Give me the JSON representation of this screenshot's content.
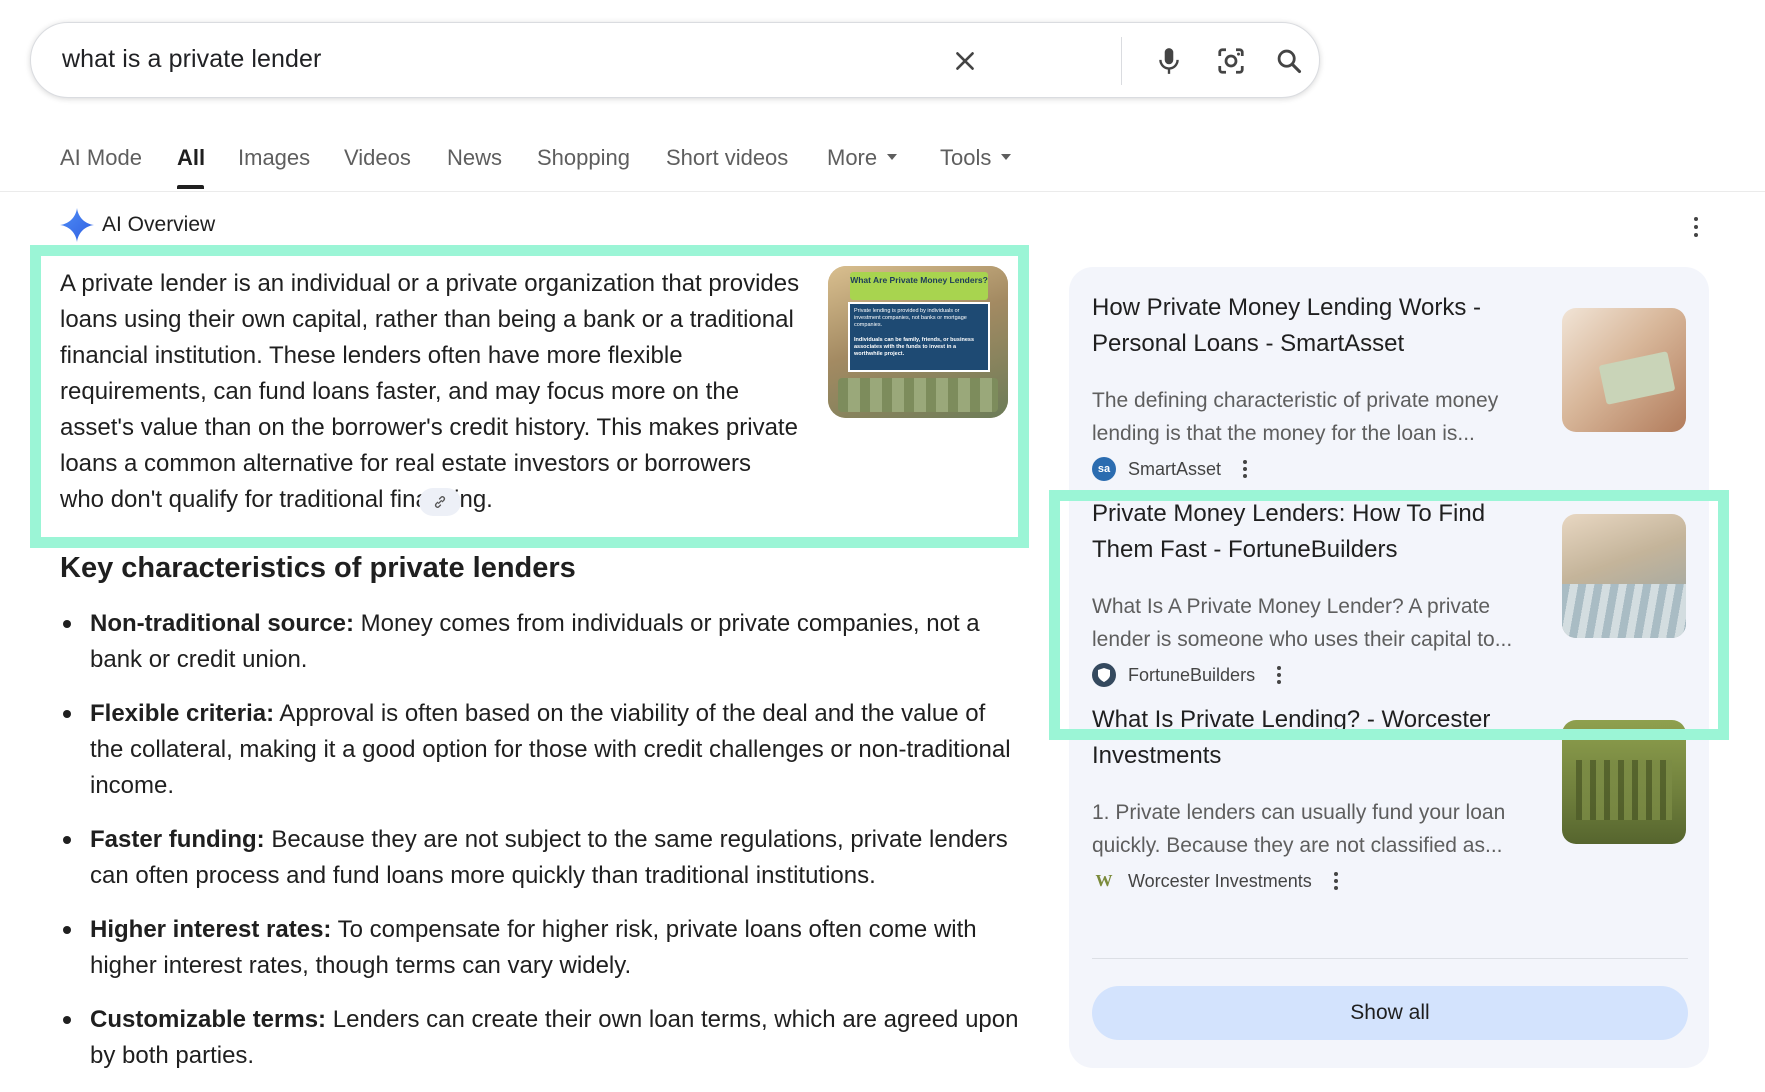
{
  "search": {
    "query": "what is a private lender",
    "clear_icon": "close-icon",
    "voice_icon": "mic-icon",
    "lens_icon": "camera-lens-icon",
    "search_icon": "search-icon"
  },
  "tabs": {
    "items": [
      {
        "label": "AI Mode"
      },
      {
        "label": "All"
      },
      {
        "label": "Images"
      },
      {
        "label": "Videos"
      },
      {
        "label": "News"
      },
      {
        "label": "Shopping"
      },
      {
        "label": "Short videos"
      },
      {
        "label": "More"
      },
      {
        "label": "Tools"
      }
    ],
    "active": "All"
  },
  "ai_overview": {
    "label": "AI Overview",
    "paragraph": "A private lender is an individual or a private organization that provides loans using their own capital, rather than being a bank or a traditional financial institution. These lenders often have more flexible requirements, can fund loans faster, and may focus more on the asset's value than on the borrower's credit history. This makes private loans a common alternative for real estate investors or borrowers who don't qualify for traditional financing.",
    "image": {
      "title": "What Are Private Money Lenders?",
      "line1": "Private lending is provided by individuals or investment companies, not banks or mortgage companies.",
      "line2": "Individuals can be family, friends, or business associates with the funds to invest in a worthwhile project."
    }
  },
  "key_characteristics": {
    "title": "Key characteristics of private lenders",
    "items": [
      {
        "term": "Non-traditional source:",
        "text": " Money comes from individuals or private companies, not a bank or credit union."
      },
      {
        "term": "Flexible criteria:",
        "text": " Approval is often based on the viability of the deal and the value of the collateral, making it a good option for those with credit challenges or non-traditional income."
      },
      {
        "term": "Faster funding:",
        "text": " Because they are not subject to the same regulations, private lenders can often process and fund loans more quickly than traditional institutions."
      },
      {
        "term": "Higher interest rates:",
        "text": " To compensate for higher risk, private loans often come with higher interest rates, though terms can vary widely."
      },
      {
        "term": "Customizable terms:",
        "text": " Lenders can create their own loan terms, which are agreed upon by both parties."
      }
    ]
  },
  "sources": {
    "cards": [
      {
        "title": "How Private Money Lending Works - Personal Loans - SmartAsset",
        "snippet": "The defining characteristic of private money lending is that the money for the loan is...",
        "source": "SmartAsset",
        "favicon": "sa",
        "favicon_color": "#2b6cb0"
      },
      {
        "title": "Private Money Lenders: How To Find Them Fast - FortuneBuilders",
        "snippet": "What Is A Private Money Lender? A private lender is someone who uses their capital to...",
        "source": "FortuneBuilders",
        "favicon": "",
        "favicon_color": "#34495e"
      },
      {
        "title": "What Is Private Lending? - Worcester Investments",
        "snippet": "1. Private lenders can usually fund your loan quickly. Because they are not classified as...",
        "source": "Worcester Investments",
        "favicon": "W",
        "favicon_color": "#7a8a3a"
      }
    ],
    "show_all": "Show all"
  },
  "colors": {
    "highlight": "#9bf5d6",
    "panel_bg": "#f3f5fb",
    "show_all_bg": "#d3e3fd"
  }
}
